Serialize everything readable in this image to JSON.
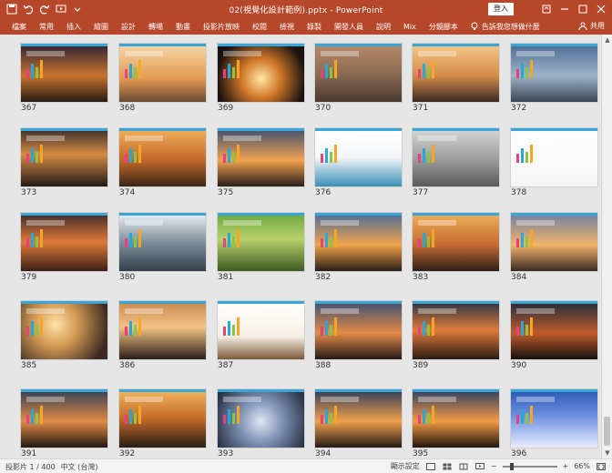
{
  "app": {
    "doc_title": "02(視覺化設計範例).pptx  -  PowerPoint",
    "sign_in_label": "登入",
    "share_label": "共用",
    "tell_me_label": "告訴我您想做什麼"
  },
  "ribbon": {
    "tabs": [
      "檔案",
      "常用",
      "插入",
      "繪圖",
      "設計",
      "轉場",
      "動畫",
      "投影片放映",
      "校閱",
      "檢視",
      "錄製",
      "開發人員",
      "說明",
      "Mix",
      "分鏡腳本"
    ]
  },
  "slides": [
    {
      "num": "367",
      "bg": "linear-gradient(180deg,#2a2233 0%,#c9732f 55%,#2a1a14 100%)"
    },
    {
      "num": "368",
      "bg": "linear-gradient(180deg,#f5d7a7 0%,#e39a52 60%,#6a4a33 100%)"
    },
    {
      "num": "369",
      "bg": "radial-gradient(circle at 50% 60%,#ffe7a3 0%,#d1782a 35%,#1b1310 80%)"
    },
    {
      "num": "370",
      "bg": "linear-gradient(180deg,#b58a6a 0%,#8e6d55 50%,#4a3a30 100%)"
    },
    {
      "num": "371",
      "bg": "linear-gradient(180deg,#f4c98a 0%,#d48b49 55%,#3a2a22 100%)"
    },
    {
      "num": "372",
      "bg": "linear-gradient(180deg,#4c6b93 0%,#9db3c9 55%,#3d4756 100%)"
    },
    {
      "num": "373",
      "bg": "linear-gradient(180deg,#352b2a 0%,#d58a43 45%,#241b18 100%)"
    },
    {
      "num": "374",
      "bg": "linear-gradient(180deg,#f2b25d 0%,#c2672a 55%,#3a2516 100%)"
    },
    {
      "num": "375",
      "bg": "linear-gradient(180deg,#3b4f73 0%,#f2a24f 55%,#2a1e1b 100%)"
    },
    {
      "num": "376",
      "bg": "linear-gradient(180deg,#ffffff 0%,#f4f6f8 50%,#3b8fb7 100%)"
    },
    {
      "num": "377",
      "bg": "linear-gradient(180deg,#d8d8d8 0%,#9a9a9a 55%,#5a5a5a 100%)"
    },
    {
      "num": "378",
      "bg": "linear-gradient(180deg,#ffffff 0%,#f6f6f6 100%)"
    },
    {
      "num": "379",
      "bg": "linear-gradient(180deg,#3b2a2a 0%,#e07a3a 50%,#3a2016 100%)"
    },
    {
      "num": "380",
      "bg": "linear-gradient(180deg,#eef2f5 0%,#7e8f9c 50%,#31404b 100%)"
    },
    {
      "num": "381",
      "bg": "linear-gradient(180deg,#6aa63f 0%,#b7d06a 45%,#3e5a22 100%)"
    },
    {
      "num": "382",
      "bg": "linear-gradient(180deg,#4a6a9c 0%,#f0a34a 55%,#2a1e18 100%)"
    },
    {
      "num": "383",
      "bg": "linear-gradient(180deg,#f0b15b 0%,#c46a32 55%,#2d1f18 100%)"
    },
    {
      "num": "384",
      "bg": "linear-gradient(180deg,#6c7ea4 0%,#f2b46a 55%,#3a2a22 100%)"
    },
    {
      "num": "385",
      "bg": "radial-gradient(circle at 40% 40%,#ffe2a6 0%,#d49a54 35%,#3a2a22 85%)"
    },
    {
      "num": "386",
      "bg": "linear-gradient(180deg,#c8874e 0%,#f2c383 45%,#2a1e18 100%)"
    },
    {
      "num": "387",
      "bg": "linear-gradient(180deg,#ffffff 0%,#f7f0e6 60%,#7b5b3b 100%)"
    },
    {
      "num": "388",
      "bg": "linear-gradient(180deg,#3a4f72 0%,#e38a48 55%,#241a16 100%)"
    },
    {
      "num": "389",
      "bg": "linear-gradient(180deg,#243246 0%,#e07a3a 50%,#2a1a12 100%)"
    },
    {
      "num": "390",
      "bg": "linear-gradient(180deg,#1d2a3d 0%,#c05b2c 55%,#15110f 100%)"
    },
    {
      "num": "391",
      "bg": "linear-gradient(180deg,#2f3d57 0%,#e08b45 55%,#231814 100%)"
    },
    {
      "num": "392",
      "bg": "linear-gradient(180deg,#f2b760 0%,#c46a2a 50%,#281d16 100%)"
    },
    {
      "num": "393",
      "bg": "radial-gradient(circle at 50% 55%,#dfe7f3 0%,#7e92b5 40%,#2b3447 90%)"
    },
    {
      "num": "394",
      "bg": "linear-gradient(180deg,#2c3a5a 0%,#f0a04c 55%,#231a16 100%)"
    },
    {
      "num": "395",
      "bg": "linear-gradient(180deg,#2b3d63 0%,#f29a44 55%,#21150f 100%)"
    },
    {
      "num": "396",
      "bg": "linear-gradient(180deg,#2a57b3 0%,#6c8fe0 45%,#e7ecff 100%)"
    }
  ],
  "status": {
    "slide_info": "投影片 1 / 400",
    "language": "中文 (台灣)",
    "display_settings": "顯示設定",
    "zoom": "66%"
  }
}
